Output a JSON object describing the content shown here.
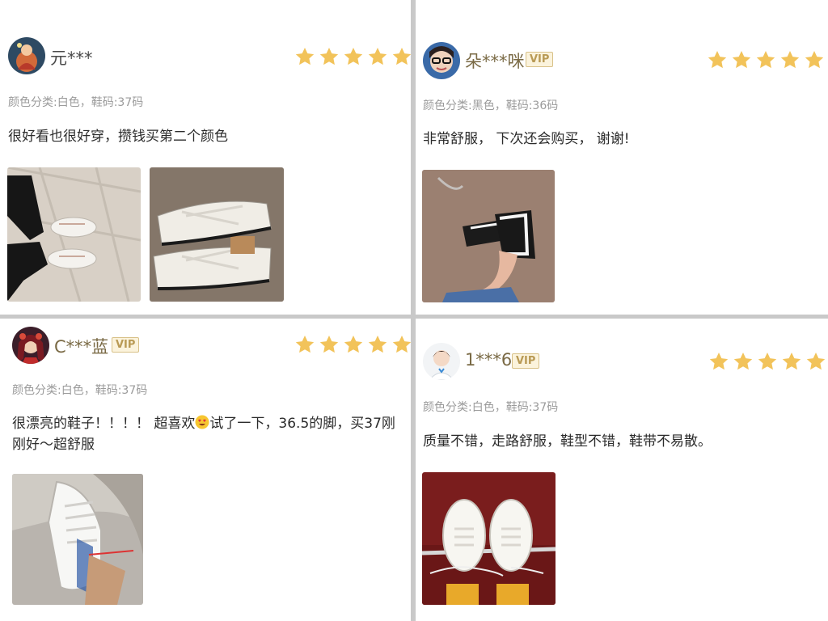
{
  "colors": {
    "star": "#f2c35a",
    "divider": "#c9c9c9",
    "vip_text": "#b99a55",
    "spec_text": "#9b9b9b"
  },
  "reviews": [
    {
      "username": "元***",
      "vip": "",
      "rating": 5,
      "spec": "颜色分类:白色，鞋码:37码",
      "comment": "很好看也很好穿，攒钱买第二个颜色",
      "photos": [
        "white-sneakers-on-feet",
        "white-sneakers-on-floor"
      ]
    },
    {
      "username": "朵***咪",
      "vip": "VIP",
      "rating": 5,
      "spec": "颜色分类:黑色，鞋码:36码",
      "comment": "非常舒服， 下次还会购买， 谢谢!",
      "photos": [
        "black-sneakers-on-feet"
      ]
    },
    {
      "username": "C***蓝",
      "vip": "VIP",
      "rating": 5,
      "spec": "颜色分类:白色，鞋码:37码",
      "comment_before_emoji": "很漂亮的鞋子！！！！ 超喜欢",
      "emoji_icon": "heart-eyes-emoji",
      "comment_after_emoji": "试了一下，36.5的脚，买37刚刚好～超舒服",
      "photos": [
        "white-sneaker-with-tag"
      ]
    },
    {
      "username": "1***6",
      "vip": "VIP",
      "rating": 5,
      "spec": "颜色分类:白色，鞋码:37码",
      "comment": "质量不错，走路舒服，鞋型不错，鞋带不易散。",
      "photos": [
        "white-sneakers-yellow-socks"
      ]
    }
  ]
}
